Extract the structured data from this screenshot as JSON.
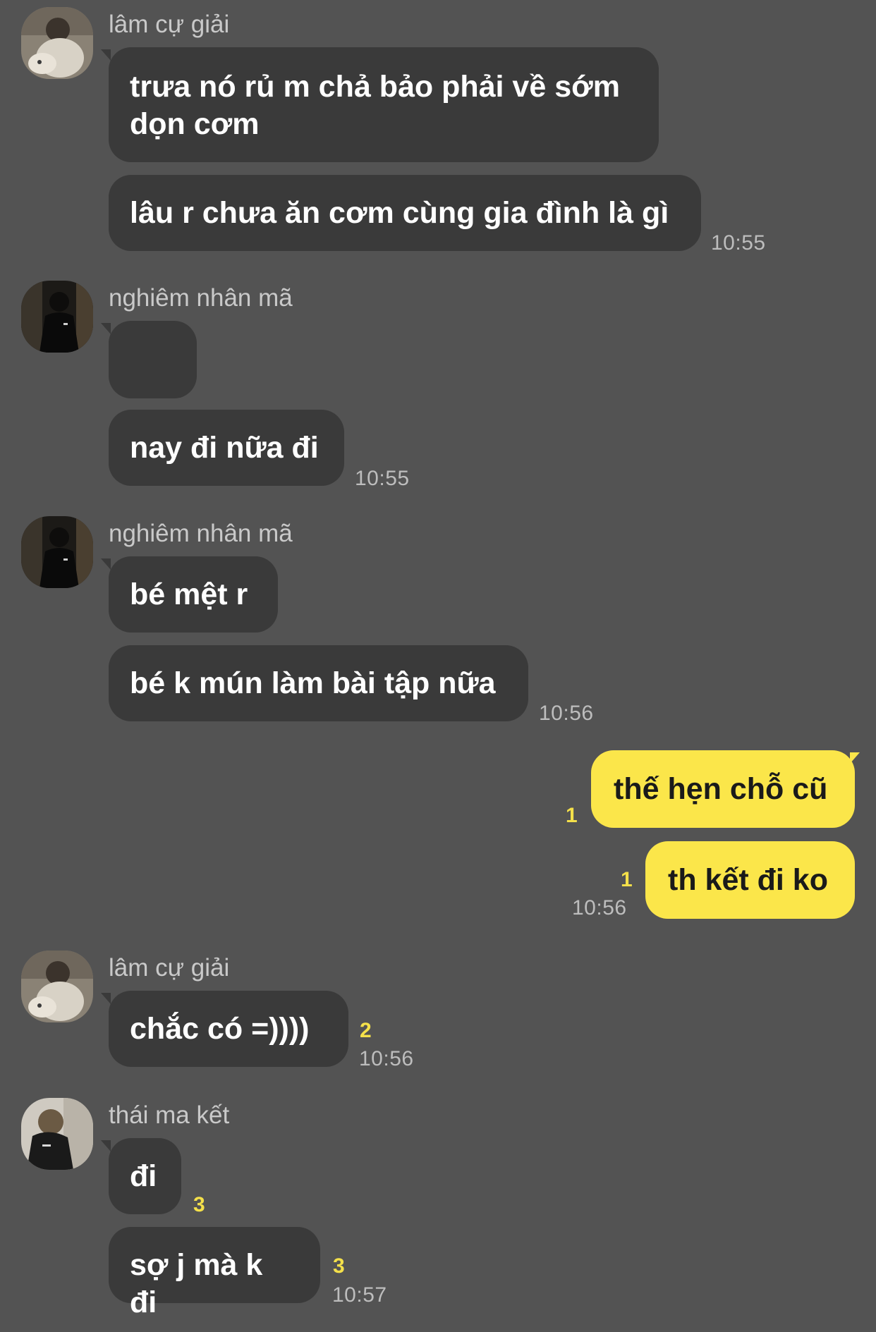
{
  "messages": [
    {
      "sender": "lâm cự giải",
      "lines": [
        "trưa nó rủ m chả bảo phải về sớm\ndọn cơm",
        "lâu r chưa ăn cơm cùng gia đình là gì"
      ],
      "time": "10:55"
    },
    {
      "sender": "nghiêm nhân mã",
      "emoji": "disappointed-face-icon",
      "lines": [
        "nay đi nữa đi"
      ],
      "time": "10:55"
    },
    {
      "sender": "nghiêm nhân mã",
      "lines": [
        "bé mệt r",
        "bé k mún làm bài tập nữa"
      ],
      "time": "10:56"
    },
    {
      "outgoing": true,
      "lines": [
        "thế hẹn chỗ cũ",
        "th kết đi ko"
      ],
      "unread": [
        "1",
        "1"
      ],
      "time": "10:56"
    },
    {
      "sender": "lâm cự giải",
      "lines": [
        "chắc có =))))"
      ],
      "unread": [
        "2"
      ],
      "time": "10:56"
    },
    {
      "sender": "thái ma kết",
      "lines": [
        "đi",
        "sợ j mà k đi"
      ],
      "unread": [
        "3",
        "3"
      ],
      "time": "10:57"
    }
  ],
  "colors": {
    "background": "#535353",
    "incoming_bubble": "#3a3a3a",
    "outgoing_bubble": "#fbe64a",
    "unread_count": "#f4e04a",
    "timestamp": "#bdbdbd"
  }
}
